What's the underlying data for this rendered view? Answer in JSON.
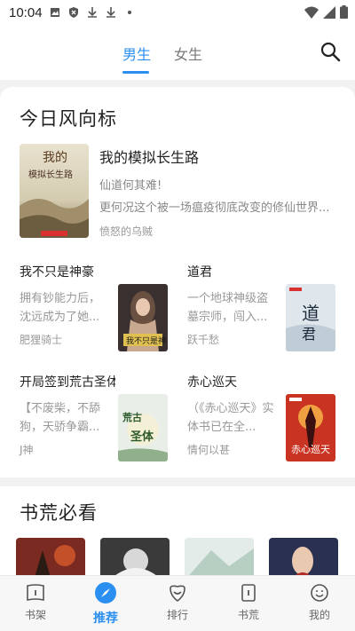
{
  "status": {
    "time": "10:04"
  },
  "tabs": {
    "male": "男生",
    "female": "女生"
  },
  "section1": {
    "title": "今日风向标",
    "featured": {
      "title": "我的模拟长生路",
      "desc1": "仙道何其难!",
      "desc2": "更何况这个被一场瘟疫彻底改变的修仙世界...",
      "author": "愤怒的乌贼",
      "cover_text": "我的模拟长生路"
    },
    "books": [
      {
        "title": "我不只是神豪",
        "desc": "拥有钞能力后，沈远成为了她...",
        "author": "肥狸骑士",
        "cover_text": "我不只是神豪"
      },
      {
        "title": "道君",
        "desc": "一个地球神级盗墓宗师，闯入...",
        "author": "跃千愁",
        "cover_text": "道君"
      },
      {
        "title": "开局签到荒古圣体",
        "desc": "【不废柴，不舔狗，天骄争霸...",
        "author": "J神",
        "cover_text": "荒古圣体"
      },
      {
        "title": "赤心巡天",
        "desc": "（《赤心巡天》实体书已在全...",
        "author": "情何以甚",
        "cover_text": "赤心巡天"
      }
    ]
  },
  "section2": {
    "title": "书荒必看"
  },
  "bottom_nav": [
    {
      "label": "书架",
      "icon": "bookshelf-icon"
    },
    {
      "label": "推荐",
      "icon": "recommend-icon"
    },
    {
      "label": "排行",
      "icon": "ranking-icon"
    },
    {
      "label": "书荒",
      "icon": "book-drought-icon"
    },
    {
      "label": "我的",
      "icon": "profile-icon"
    }
  ],
  "colors": {
    "accent": "#2a8ff0",
    "text": "#222222",
    "muted": "#999999"
  }
}
